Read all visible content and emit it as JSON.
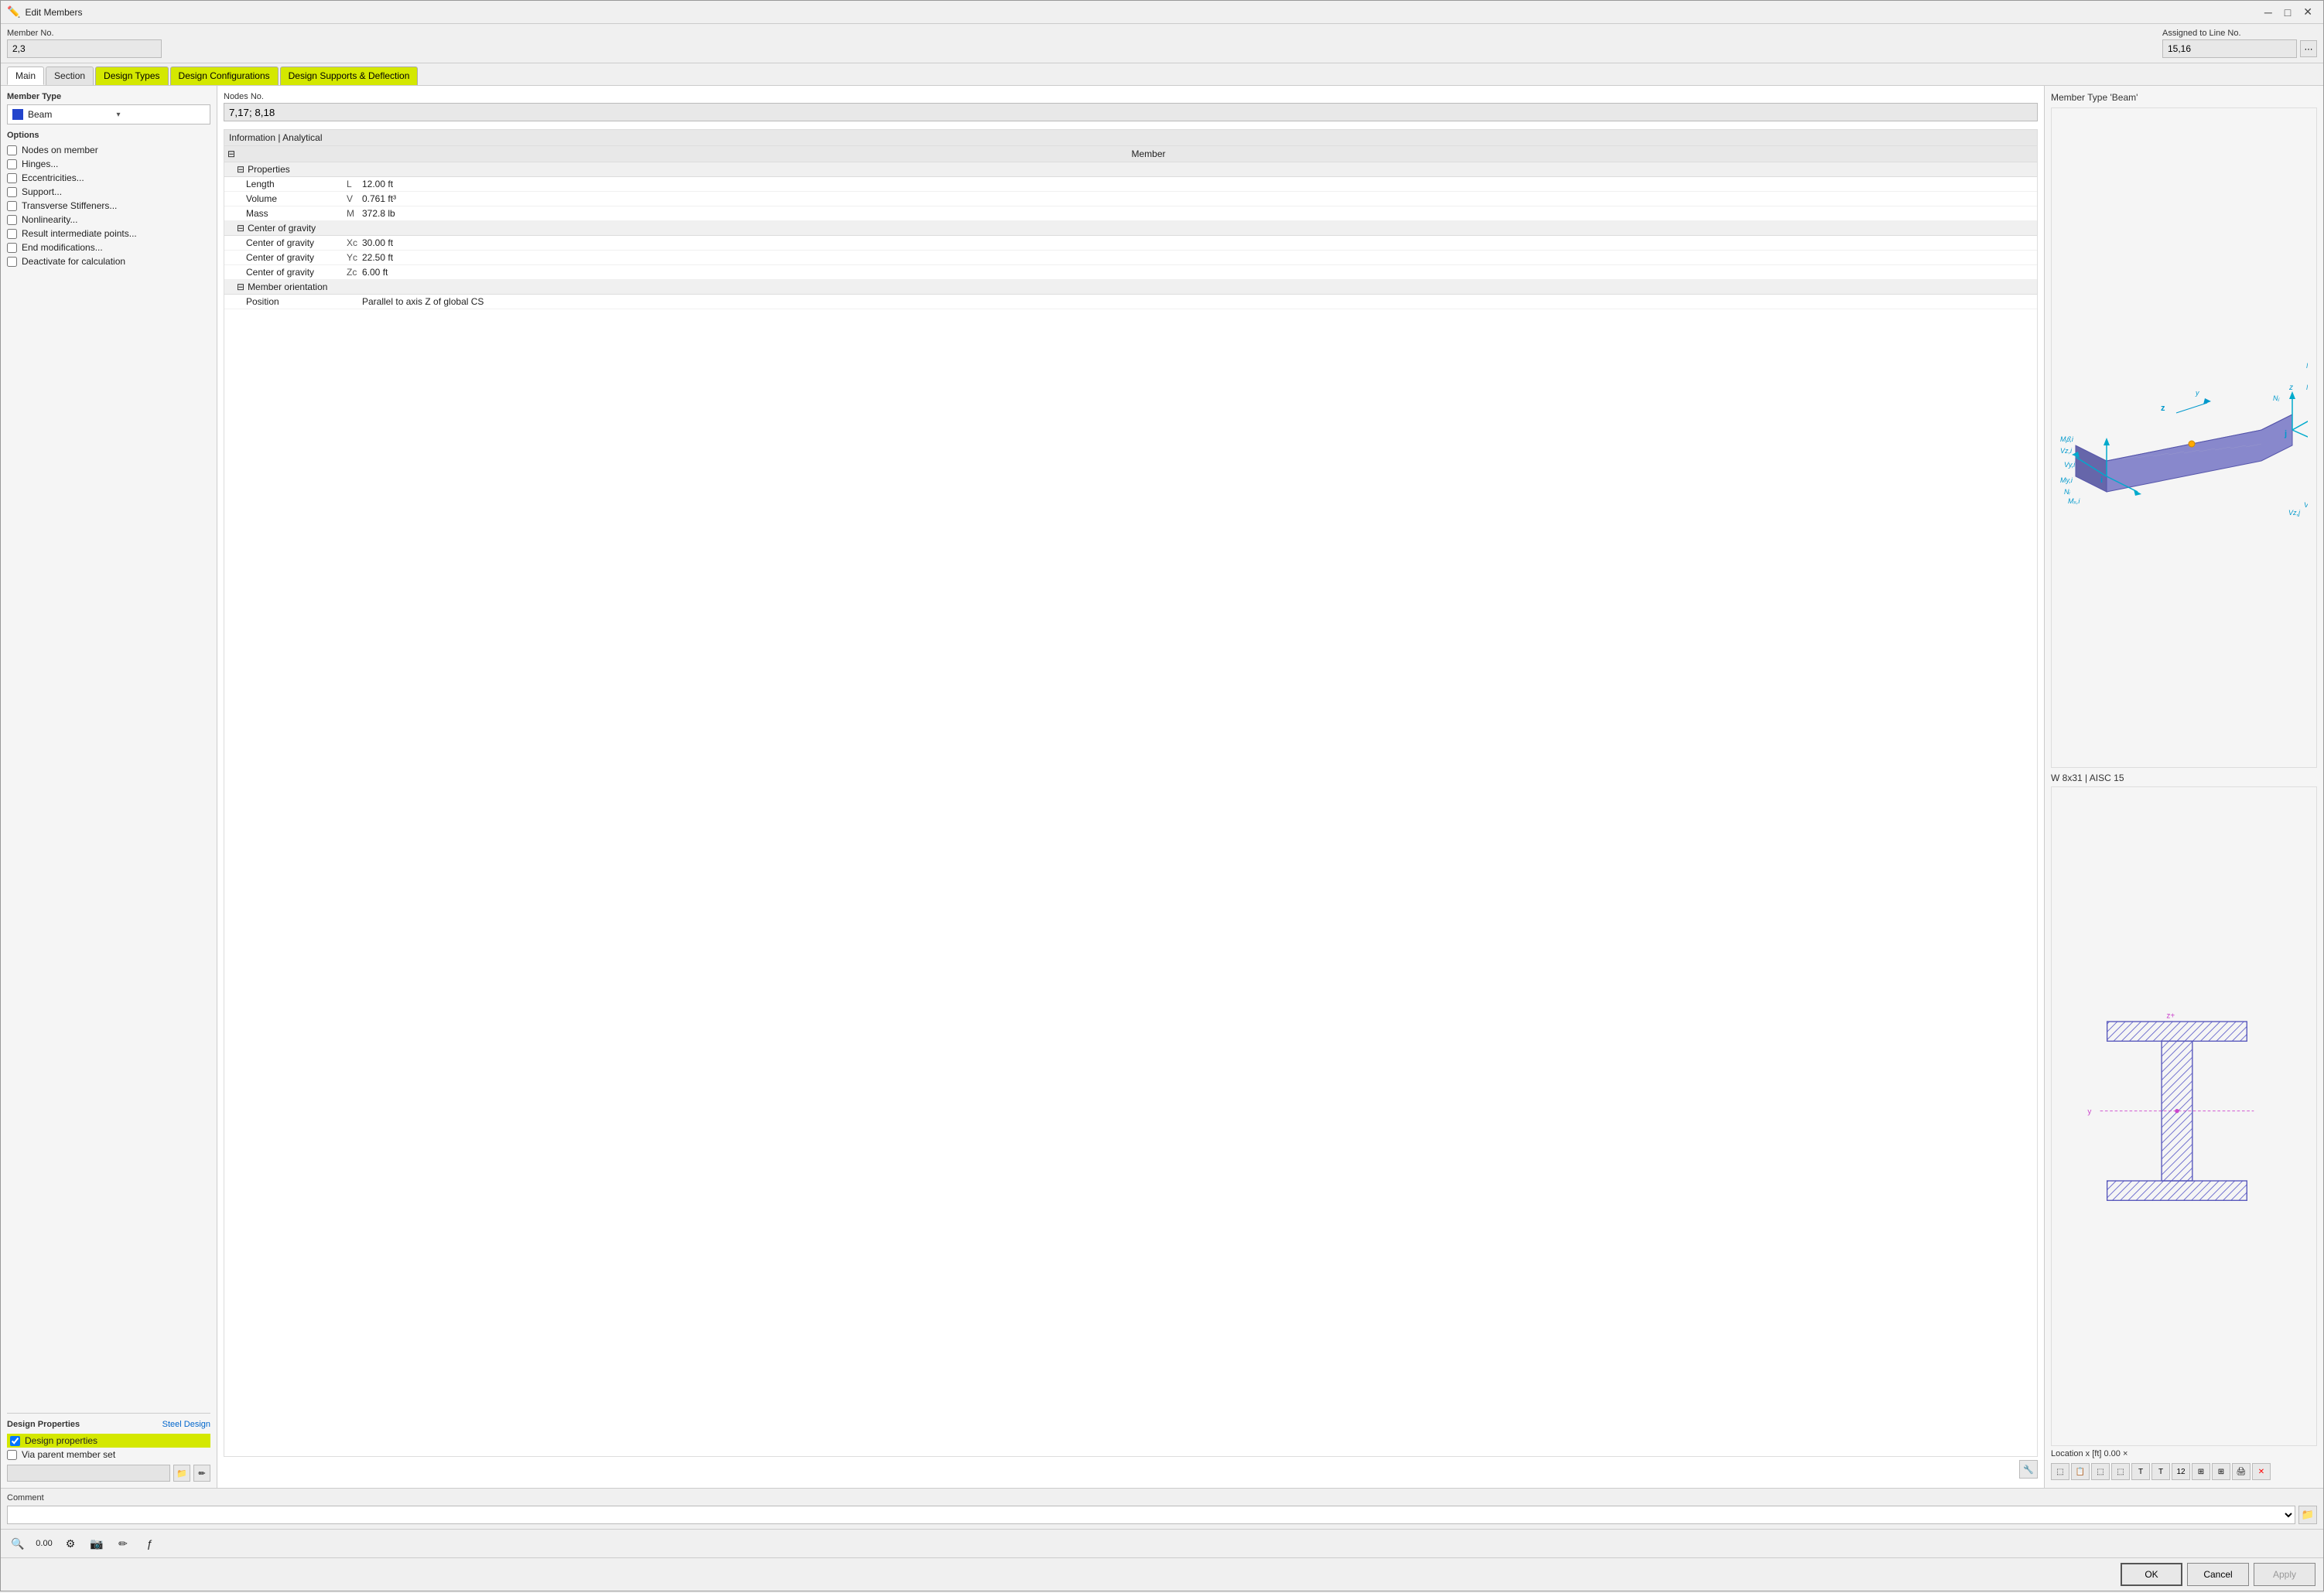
{
  "titleBar": {
    "title": "Edit Members",
    "icon": "✏️"
  },
  "header": {
    "memberNoLabel": "Member No.",
    "memberNoValue": "2,3",
    "assignedToLineLabel": "Assigned to Line No.",
    "assignedToLineValue": "15,16"
  },
  "tabs": [
    {
      "id": "main",
      "label": "Main",
      "active": true,
      "highlighted": false
    },
    {
      "id": "section",
      "label": "Section",
      "active": false,
      "highlighted": false
    },
    {
      "id": "designTypes",
      "label": "Design Types",
      "active": false,
      "highlighted": true
    },
    {
      "id": "designConfig",
      "label": "Design Configurations",
      "active": false,
      "highlighted": true
    },
    {
      "id": "designSupports",
      "label": "Design Supports & Deflection",
      "active": false,
      "highlighted": true
    }
  ],
  "leftPanel": {
    "memberTypeLabel": "Member Type",
    "memberTypeValue": "Beam",
    "memberTypeColor": "#2244cc",
    "optionsLabel": "Options",
    "options": [
      {
        "id": "nodes-on-member",
        "label": "Nodes on member",
        "checked": false
      },
      {
        "id": "hinges",
        "label": "Hinges...",
        "checked": false
      },
      {
        "id": "eccentricities",
        "label": "Eccentricities...",
        "checked": false
      },
      {
        "id": "support",
        "label": "Support...",
        "checked": false
      },
      {
        "id": "transverse-stiffeners",
        "label": "Transverse Stiffeners...",
        "checked": false
      },
      {
        "id": "nonlinearity",
        "label": "Nonlinearity...",
        "checked": false
      },
      {
        "id": "result-intermediate",
        "label": "Result intermediate points...",
        "checked": false
      },
      {
        "id": "end-modifications",
        "label": "End modifications...",
        "checked": false
      },
      {
        "id": "deactivate",
        "label": "Deactivate for calculation",
        "checked": false
      }
    ],
    "designPropertiesLabel": "Design Properties",
    "steelDesignLabel": "Steel Design",
    "designPropItems": [
      {
        "id": "design-properties",
        "label": "Design properties",
        "checked": true,
        "highlighted": true
      },
      {
        "id": "via-parent",
        "label": "Via parent member set",
        "checked": false,
        "highlighted": false
      }
    ]
  },
  "middlePanel": {
    "nodesNoLabel": "Nodes No.",
    "nodesNoValue": "7,17; 8,18",
    "infoHeader": "Information | Analytical",
    "groups": [
      {
        "id": "member",
        "label": "Member",
        "expanded": true,
        "subgroups": [
          {
            "id": "properties",
            "label": "Properties",
            "expanded": true,
            "rows": [
              {
                "name": "Length",
                "key": "L",
                "value": "12.00 ft"
              },
              {
                "name": "Volume",
                "key": "V",
                "value": "0.761 ft³"
              },
              {
                "name": "Mass",
                "key": "M",
                "value": "372.8 lb"
              }
            ]
          },
          {
            "id": "center-of-gravity",
            "label": "Center of gravity",
            "expanded": true,
            "rows": [
              {
                "name": "Center of gravity",
                "key": "Xc",
                "value": "30.00 ft"
              },
              {
                "name": "Center of gravity",
                "key": "Yc",
                "value": "22.50 ft"
              },
              {
                "name": "Center of gravity",
                "key": "Zc",
                "value": "6.00 ft"
              }
            ]
          },
          {
            "id": "member-orientation",
            "label": "Member orientation",
            "expanded": true,
            "rows": [
              {
                "name": "Position",
                "key": "",
                "value": "Parallel to axis Z of global CS"
              }
            ]
          }
        ]
      }
    ]
  },
  "rightPanel": {
    "diagramLabel": "Member Type 'Beam'",
    "sectionLabel": "W 8x31 | AISC 15",
    "locationLabel": "Location x [ft]",
    "locationValue": "0.00"
  },
  "comment": {
    "label": "Comment"
  },
  "footer": {
    "okLabel": "OK",
    "cancelLabel": "Cancel",
    "applyLabel": "Apply"
  },
  "bottomToolbar": {
    "tools": [
      "🔍",
      "0.00",
      "⚙",
      "📷",
      "✏",
      "ƒ"
    ]
  }
}
